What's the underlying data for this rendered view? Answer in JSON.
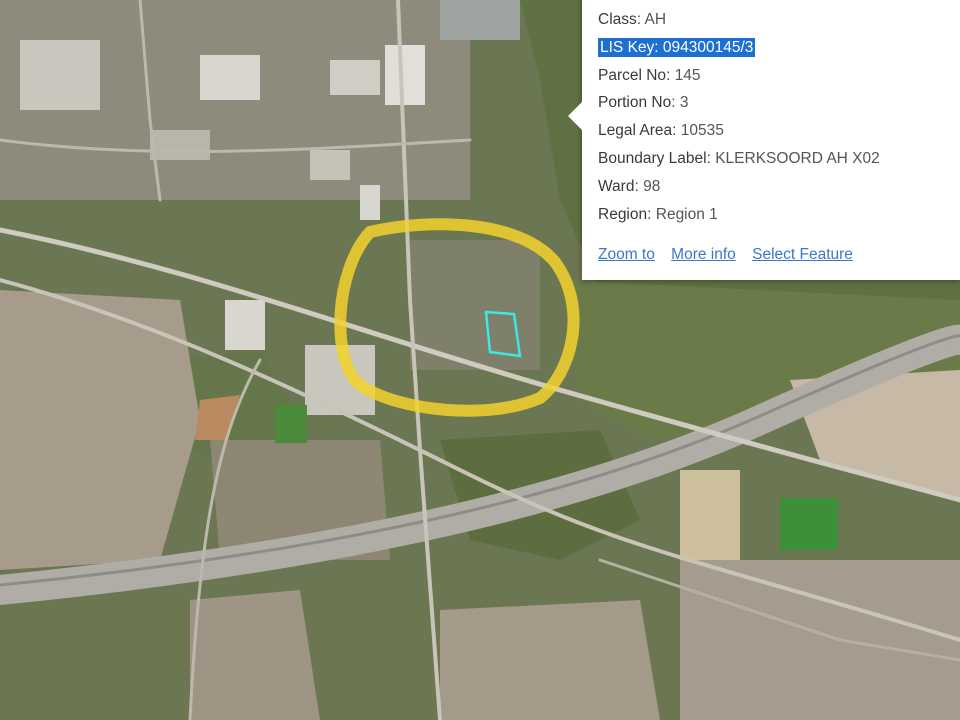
{
  "popup": {
    "attributes": [
      {
        "name": "Class",
        "value": "AH"
      },
      {
        "name": "LIS Key",
        "value": "094300145/3"
      },
      {
        "name": "Parcel No",
        "value": "145"
      },
      {
        "name": "Portion No",
        "value": "3"
      },
      {
        "name": "Legal Area",
        "value": "10535"
      },
      {
        "name": "Boundary Label",
        "value": "KLERKSOORD AH X02"
      },
      {
        "name": "Ward",
        "value": "98"
      },
      {
        "name": "Region",
        "value": "Region 1"
      }
    ],
    "selected_attribute": "LIS Key",
    "actions": {
      "zoom_to": "Zoom to",
      "more_info": "More info",
      "select_feature": "Select Feature"
    }
  },
  "map": {
    "basemap": "satellite-imagery",
    "annotations": [
      {
        "type": "freehand-circle",
        "color": "#f2d22e"
      },
      {
        "type": "selected-parcel-outline",
        "color": "#3ee6e6"
      }
    ]
  }
}
